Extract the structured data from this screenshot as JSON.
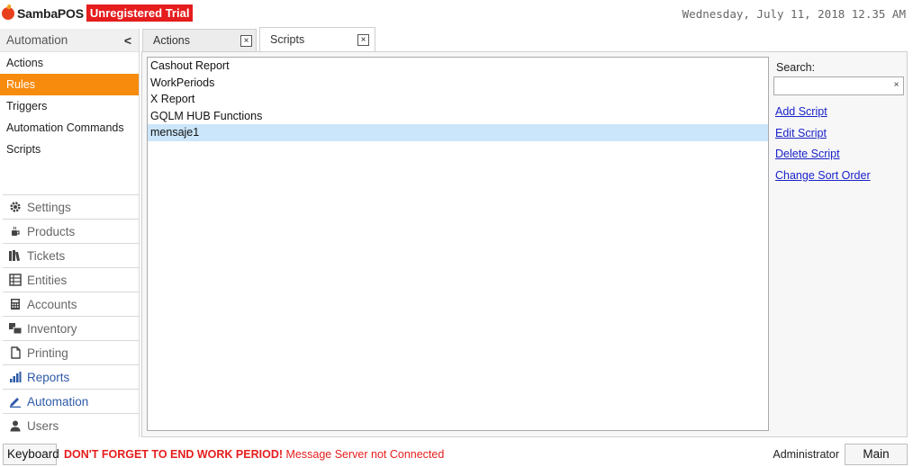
{
  "header": {
    "app_name": "SambaPOS",
    "trial_badge": "Unregistered Trial",
    "datetime": "Wednesday, July 11, 2018 12.35 AM"
  },
  "sidebar": {
    "section_title": "Automation",
    "collapse_glyph": "<",
    "items": [
      {
        "label": "Actions",
        "active": false
      },
      {
        "label": "Rules",
        "active": true
      },
      {
        "label": "Triggers",
        "active": false
      },
      {
        "label": "Automation Commands",
        "active": false
      },
      {
        "label": "Scripts",
        "active": false
      }
    ],
    "categories": [
      {
        "label": "Settings",
        "icon": "gear-icon"
      },
      {
        "label": "Products",
        "icon": "coffee-cup-icon"
      },
      {
        "label": "Tickets",
        "icon": "books-icon"
      },
      {
        "label": "Entities",
        "icon": "table-list-icon"
      },
      {
        "label": "Accounts",
        "icon": "calculator-icon"
      },
      {
        "label": "Inventory",
        "icon": "boxes-icon"
      },
      {
        "label": "Printing",
        "icon": "document-icon"
      },
      {
        "label": "Reports",
        "icon": "bar-chart-icon"
      },
      {
        "label": "Automation",
        "icon": "pencil-icon"
      },
      {
        "label": "Users",
        "icon": "user-icon"
      }
    ]
  },
  "tabs": [
    {
      "label": "Actions",
      "active": false,
      "close": "×"
    },
    {
      "label": "Scripts",
      "active": true,
      "close": "×"
    }
  ],
  "scripts": {
    "rows": [
      {
        "label": "Cashout Report",
        "selected": false
      },
      {
        "label": "WorkPeriods",
        "selected": false
      },
      {
        "label": "X Report",
        "selected": false
      },
      {
        "label": "GQLM HUB Functions",
        "selected": false
      },
      {
        "label": "mensaje1",
        "selected": true
      }
    ]
  },
  "search": {
    "label": "Search:",
    "value": "",
    "clear": "×"
  },
  "actions": {
    "add": "Add Script",
    "edit": "Edit Script",
    "delete": "Delete Script",
    "sort": "Change Sort Order"
  },
  "footer": {
    "keyboard": "Keyboard",
    "warning_bold": "DON'T FORGET TO END WORK PERIOD!",
    "warning_rest": " Message Server not Connected",
    "user": "Administrator",
    "main_menu": "Main Menu"
  },
  "colors": {
    "accent_orange": "#f68b0e",
    "trial_red": "#e51d1d",
    "selection_blue": "#cbe6fa",
    "link_blue": "#1a22c8"
  }
}
